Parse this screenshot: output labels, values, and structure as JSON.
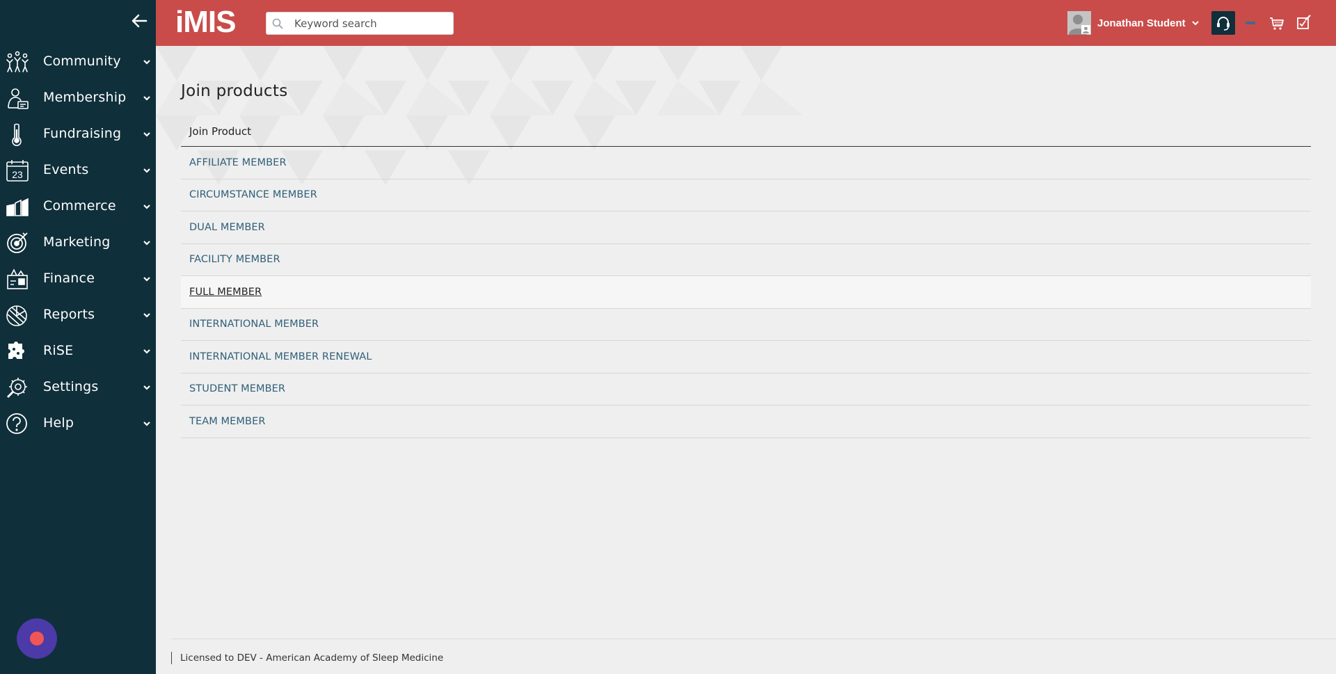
{
  "sidebar": {
    "items": [
      {
        "label": "Community",
        "icon": "community-icon"
      },
      {
        "label": "Membership",
        "icon": "membership-icon"
      },
      {
        "label": "Fundraising",
        "icon": "fundraising-icon"
      },
      {
        "label": "Events",
        "icon": "calendar-icon",
        "icon_text": "23"
      },
      {
        "label": "Commerce",
        "icon": "commerce-icon"
      },
      {
        "label": "Marketing",
        "icon": "target-icon"
      },
      {
        "label": "Finance",
        "icon": "finance-icon"
      },
      {
        "label": "Reports",
        "icon": "pie-chart-icon"
      },
      {
        "label": "RiSE",
        "icon": "puzzle-icon"
      },
      {
        "label": "Settings",
        "icon": "settings-icon"
      },
      {
        "label": "Help",
        "icon": "help-icon"
      }
    ]
  },
  "header": {
    "logo": "iMIS",
    "search_placeholder": "Keyword search",
    "user_name": "Jonathan Student",
    "brand_color": "#c94c4a"
  },
  "main": {
    "title": "Join products",
    "grid": {
      "column_header": "Join Product",
      "rows": [
        "AFFILIATE MEMBER",
        "CIRCUMSTANCE MEMBER",
        "DUAL MEMBER",
        "FACILITY MEMBER",
        "FULL MEMBER",
        "INTERNATIONAL MEMBER",
        "INTERNATIONAL MEMBER RENEWAL",
        "STUDENT MEMBER",
        "TEAM MEMBER"
      ],
      "active_row": 4
    }
  },
  "footer": {
    "license_text": "Licensed to DEV - American Academy of Sleep Medicine"
  }
}
